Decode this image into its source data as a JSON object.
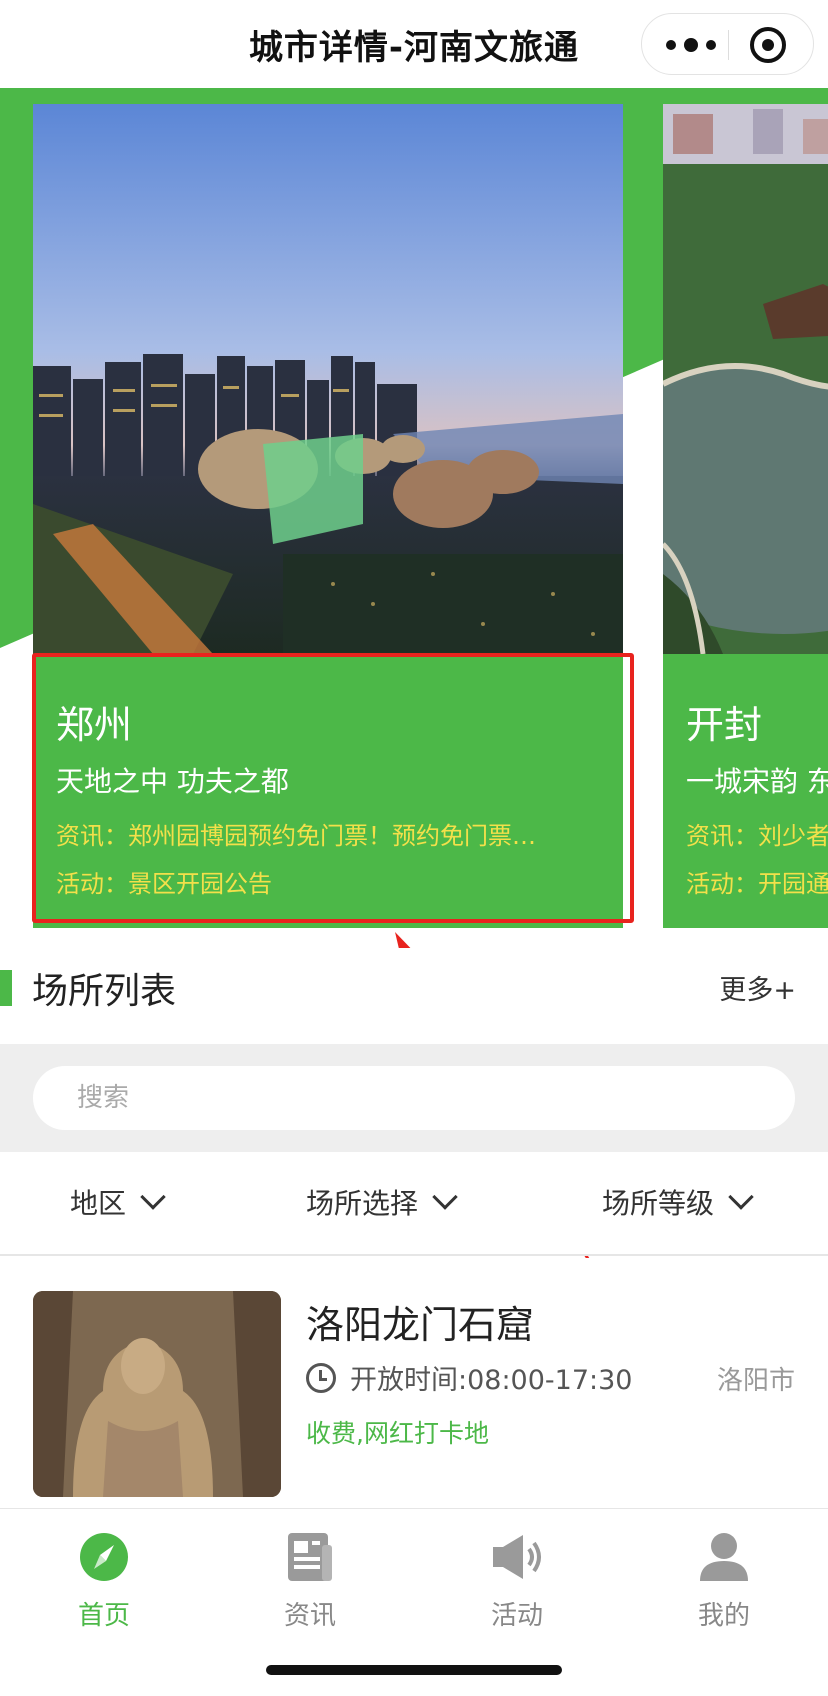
{
  "header": {
    "title": "城市详情-河南文旅通"
  },
  "colors": {
    "brand": "#4cb848",
    "highlight": "#e8231e",
    "info": "#f3e04a"
  },
  "cities": [
    {
      "name": "郑州",
      "slogan": "天地之中 功夫之都",
      "news": "资讯：郑州园博园预约免门票！预约免门票…",
      "activity": "活动：景区开园公告"
    },
    {
      "name": "开封",
      "slogan": "一城宋韵 东",
      "news": "资讯：刘少者",
      "activity": "活动：开园通"
    }
  ],
  "section": {
    "title": "场所列表",
    "more": "更多+"
  },
  "search": {
    "placeholder": "搜索"
  },
  "filters": [
    {
      "label": "地区"
    },
    {
      "label": "场所选择"
    },
    {
      "label": "场所等级"
    }
  ],
  "venue": {
    "name": "洛阳龙门石窟",
    "time": "开放时间:08:00-17:30",
    "city": "洛阳市",
    "tags": "收费,网红打卡地"
  },
  "tabs": [
    {
      "label": "首页",
      "icon": "compass-icon"
    },
    {
      "label": "资讯",
      "icon": "news-icon"
    },
    {
      "label": "活动",
      "icon": "speaker-icon"
    },
    {
      "label": "我的",
      "icon": "user-icon"
    }
  ]
}
